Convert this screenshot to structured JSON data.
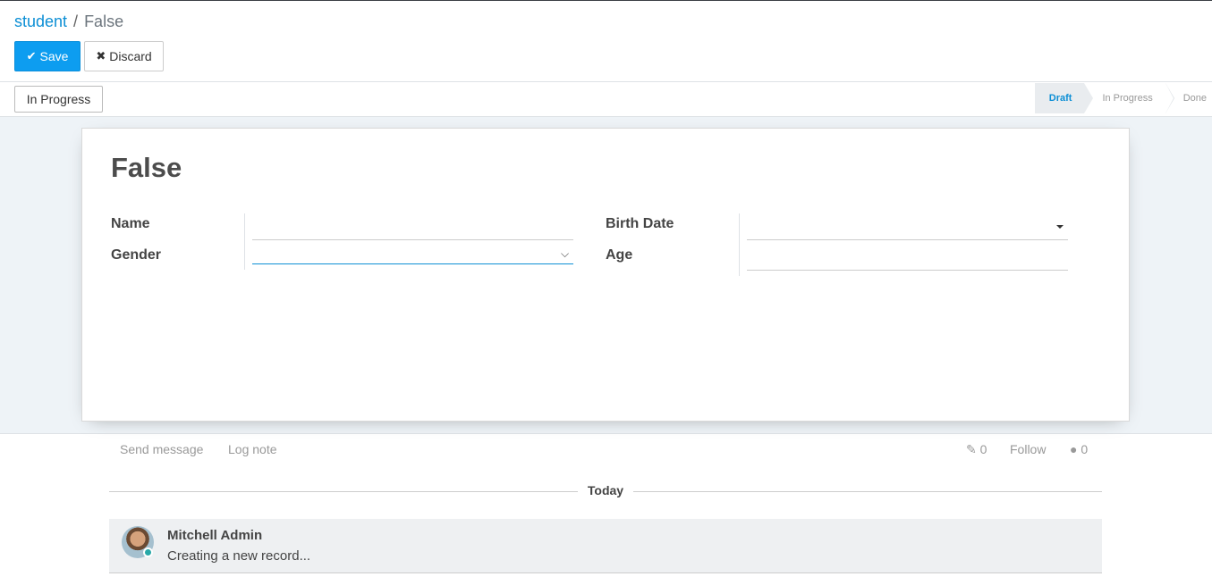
{
  "breadcrumb": {
    "parent": "student",
    "separator": "/",
    "current": "False"
  },
  "toolbar": {
    "save_label": "Save",
    "discard_label": "Discard"
  },
  "statusbar": {
    "action_button": "In Progress",
    "stages": [
      "Draft",
      "In Progress",
      "Done"
    ],
    "active_stage": "Draft"
  },
  "form": {
    "title": "False",
    "fields": {
      "name": {
        "label": "Name",
        "value": ""
      },
      "gender": {
        "label": "Gender",
        "value": ""
      },
      "birth_date": {
        "label": "Birth Date",
        "value": ""
      },
      "age": {
        "label": "Age",
        "value": ""
      }
    }
  },
  "chatter": {
    "send_message": "Send message",
    "log_note": "Log note",
    "attachments_count": "0",
    "follow": "Follow",
    "followers_count": "0",
    "date_separator": "Today",
    "messages": [
      {
        "author": "Mitchell Admin",
        "body": "Creating a new record..."
      }
    ]
  },
  "colors": {
    "primary": "#0d9df0",
    "link": "#0d8fd5",
    "background": "#eef3f7"
  }
}
